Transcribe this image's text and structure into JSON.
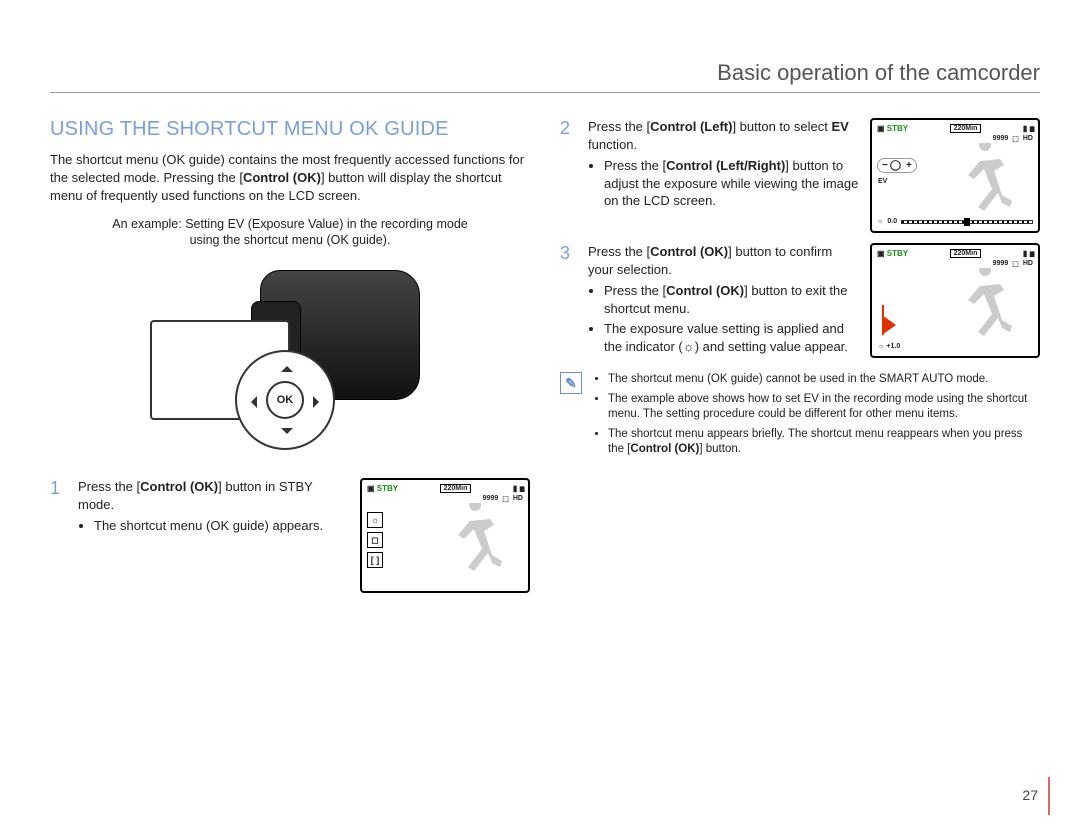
{
  "header": {
    "title": "Basic operation of the camcorder"
  },
  "section": {
    "title": "USING THE SHORTCUT MENU OK GUIDE"
  },
  "intro": {
    "p1a": "The shortcut menu (OK guide) contains the most frequently accessed functions for the selected mode. Pressing the [",
    "p1b": "Control (OK)",
    "p1c": "] button will display the shortcut menu of frequently used functions on the LCD screen."
  },
  "example_caption": {
    "line1": "An example: Setting EV (Exposure Value) in the recording mode",
    "line2": "using the shortcut menu (OK guide)."
  },
  "ok_label": "OK",
  "steps": [
    {
      "num": "1",
      "text_a": "Press the [",
      "text_b": "Control (OK)",
      "text_c": "] button in STBY mode.",
      "bullets": [
        "The shortcut menu (OK guide) appears."
      ]
    },
    {
      "num": "2",
      "text_a": "Press the [",
      "text_b": "Control (Left)",
      "text_c": "] button to select ",
      "text_d": "EV",
      "text_e": " function.",
      "bullets_rich": [
        {
          "a": "Press the [",
          "b": "Control (Left/Right)",
          "c": "] button to adjust the exposure while viewing the image on the LCD screen."
        }
      ]
    },
    {
      "num": "3",
      "text_a": "Press the [",
      "text_b": "Control (OK)",
      "text_c": "] button to confirm your selection.",
      "bullets_rich": [
        {
          "a": "Press the [",
          "b": "Control (OK)",
          "c": "] button to exit the shortcut menu."
        },
        {
          "a": "The exposure value setting is applied and the indicator (",
          "b": "",
          "c": ") and setting value appear.",
          "icon": "ev-icon"
        }
      ]
    }
  ],
  "lcd": {
    "stby": "STBY",
    "time": "220Min",
    "count": "9999",
    "hd": "HD",
    "ev_label": "EV",
    "ev_val0": "0.0",
    "ev_val1": "+1.0",
    "minus": "−",
    "plus": "+"
  },
  "notes": [
    "The shortcut menu (OK guide) cannot be used in the SMART AUTO mode.",
    "The example above shows how to set EV in the recording mode using the shortcut menu. The setting procedure could be different for other menu items.",
    "The shortcut menu appears briefly. The shortcut menu reappears when you press the [Control (OK)] button."
  ],
  "note_last_a": "The shortcut menu appears briefly. The shortcut menu reappears when you press the [",
  "note_last_b": "Control (OK)",
  "note_last_c": "] button.",
  "page_number": "27",
  "note_glyph": "✎"
}
